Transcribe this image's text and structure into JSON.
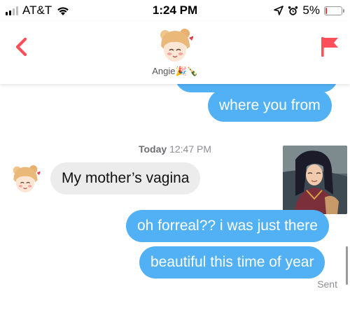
{
  "status_bar": {
    "carrier": "AT&T",
    "time": "1:24 PM",
    "battery_percent": "5%",
    "signal_bars": 2,
    "battery_level": 0.05
  },
  "header": {
    "contact_name": "Angie",
    "name_emojis": "🎉🍾",
    "back_icon": "chevron-left-icon",
    "report_icon": "flag-icon",
    "accent_color": "#fd4e5a"
  },
  "messages": {
    "outgoing_1": "where you from",
    "date_label_day": "Today",
    "date_label_time": "12:47 PM",
    "incoming_1": "My mother’s vagina",
    "outgoing_2": "oh forreal?? i was just there",
    "outgoing_3": "beautiful this time of year",
    "status": "Sent"
  },
  "colors": {
    "outgoing_bubble": "#52b1f5",
    "incoming_bubble": "#ececec"
  }
}
